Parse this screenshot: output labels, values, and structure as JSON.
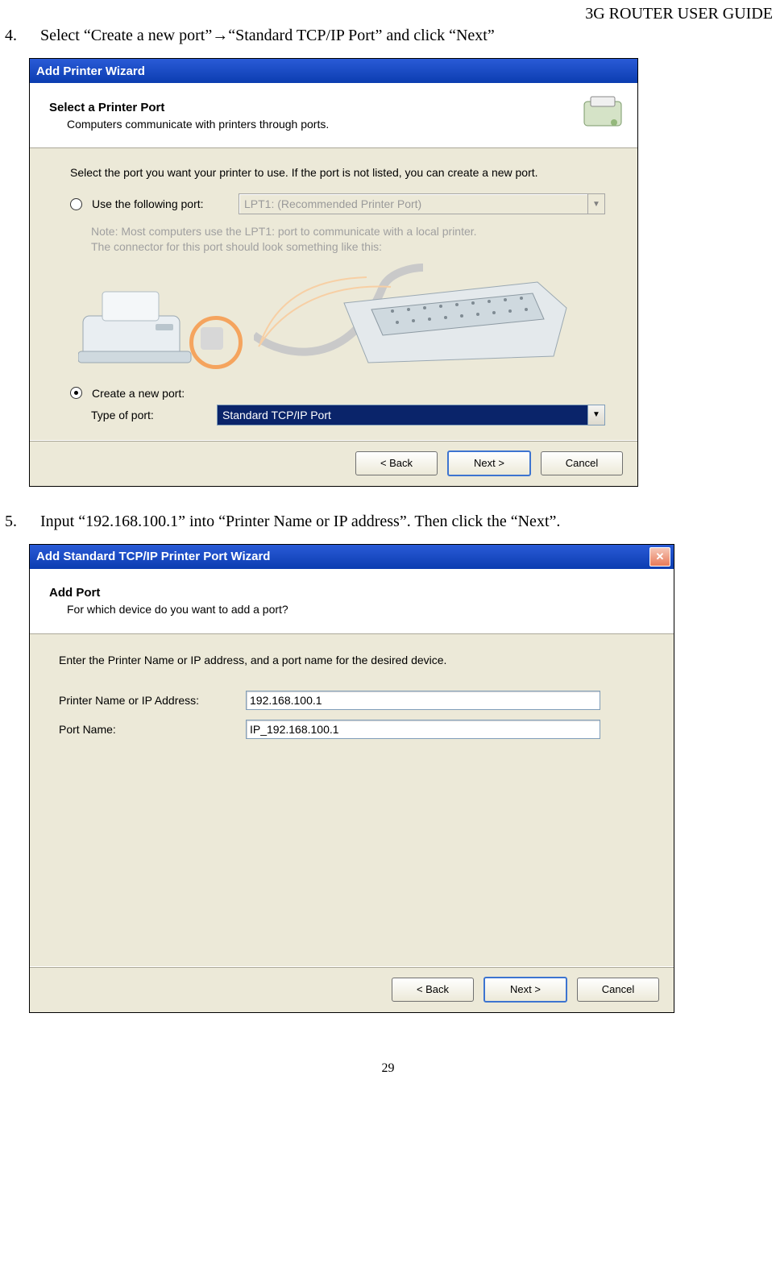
{
  "header": {
    "title": "3G ROUTER USER GUIDE"
  },
  "step4": {
    "num": "4.",
    "text": "Select “Create a new port”→“Standard TCP/IP Port” and click “Next”"
  },
  "dlg1": {
    "title": "Add Printer Wizard",
    "banner_title": "Select a Printer Port",
    "banner_sub": "Computers communicate with printers through ports.",
    "prompt": "Select the port you want your printer to use.  If the port is not listed, you can create a new port.",
    "radio_use_label": "Use the following port:",
    "use_port_value": "LPT1: (Recommended Printer Port)",
    "note_line1": "Note: Most computers use the LPT1: port to communicate with a local printer.",
    "note_line2": "The connector for this port should look something like this:",
    "radio_create_label": "Create a new port:",
    "type_label": "Type of port:",
    "type_value": "Standard TCP/IP Port",
    "btn_back": "< Back",
    "btn_next": "Next >",
    "btn_cancel": "Cancel"
  },
  "step5": {
    "num": "5.",
    "text": "Input “192.168.100.1” into “Printer Name or IP address”. Then click the “Next”."
  },
  "dlg2": {
    "title": "Add Standard TCP/IP Printer Port Wizard",
    "banner_title": "Add Port",
    "banner_sub": "For which device do you want to add a port?",
    "enter": "Enter the Printer Name or IP address, and a port name for the desired device.",
    "label_ip": "Printer Name or IP Address:",
    "value_ip": "192.168.100.1",
    "label_port": "Port Name:",
    "value_port": "IP_192.168.100.1",
    "btn_back": "< Back",
    "btn_next": "Next >",
    "btn_cancel": "Cancel"
  },
  "page_number": "29"
}
